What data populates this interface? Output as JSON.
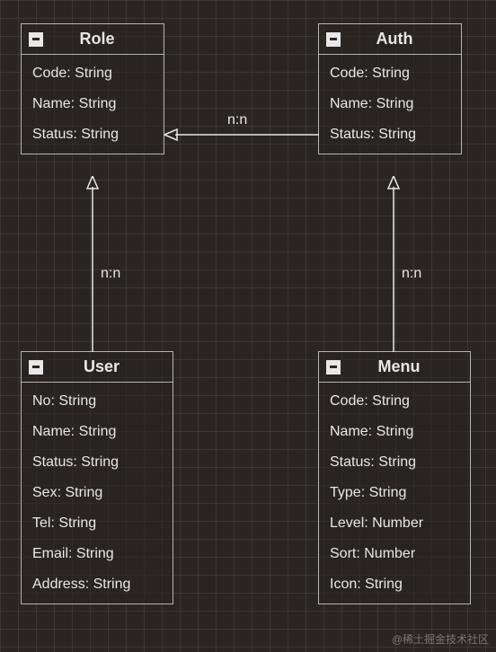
{
  "entities": {
    "role": {
      "title": "Role",
      "attributes": [
        "Code: String",
        "Name: String",
        "Status: String"
      ]
    },
    "auth": {
      "title": "Auth",
      "attributes": [
        "Code: String",
        "Name: String",
        "Status: String"
      ]
    },
    "user": {
      "title": "User",
      "attributes": [
        "No: String",
        "Name: String",
        "Status: String",
        "Sex: String",
        "Tel: String",
        "Email: String",
        "Address: String"
      ]
    },
    "menu": {
      "title": "Menu",
      "attributes": [
        "Code: String",
        "Name: String",
        "Status: String",
        "Type: String",
        "Level: Number",
        "Sort: Number",
        "Icon: String"
      ]
    }
  },
  "relations": {
    "auth_role": "n:n",
    "user_role": "n:n",
    "menu_auth": "n:n"
  },
  "watermark": "@稀土掘金技术社区"
}
